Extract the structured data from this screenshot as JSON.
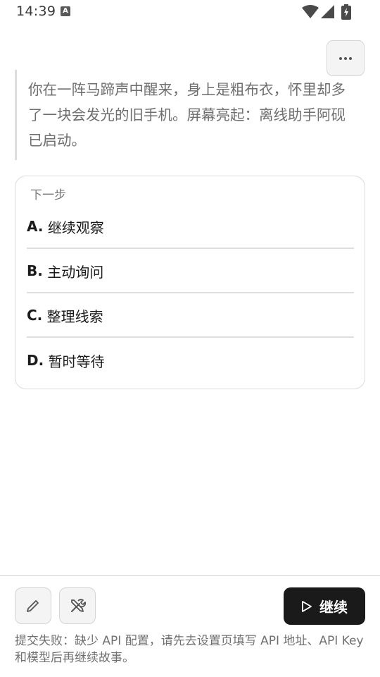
{
  "status_bar": {
    "time": "14:39",
    "notification_badge": "A"
  },
  "header": {
    "more_label": "···"
  },
  "story": {
    "text": "你在一阵马蹄声中醒来，身上是粗布衣，怀里却多了一块会发光的旧手机。屏幕亮起：离线助手阿砚已启动。"
  },
  "choices": {
    "title": "下一步",
    "items": [
      {
        "label": "A.",
        "text": "继续观察"
      },
      {
        "label": "B.",
        "text": "主动询问"
      },
      {
        "label": "C.",
        "text": "整理线索"
      },
      {
        "label": "D.",
        "text": "暂时等待"
      }
    ]
  },
  "bottom_bar": {
    "edit_icon": "pencil-icon",
    "tools_icon": "tools-icon",
    "continue_label": "继续",
    "continue_icon": "play-icon",
    "error_message": "提交失败：缺少 API 配置，请先去设置页填写 API 地址、API Key 和模型后再继续故事。"
  },
  "colors": {
    "primary_button": "#1a1a1a",
    "story_text": "#6e6e6e",
    "border": "#dcdcdc"
  }
}
